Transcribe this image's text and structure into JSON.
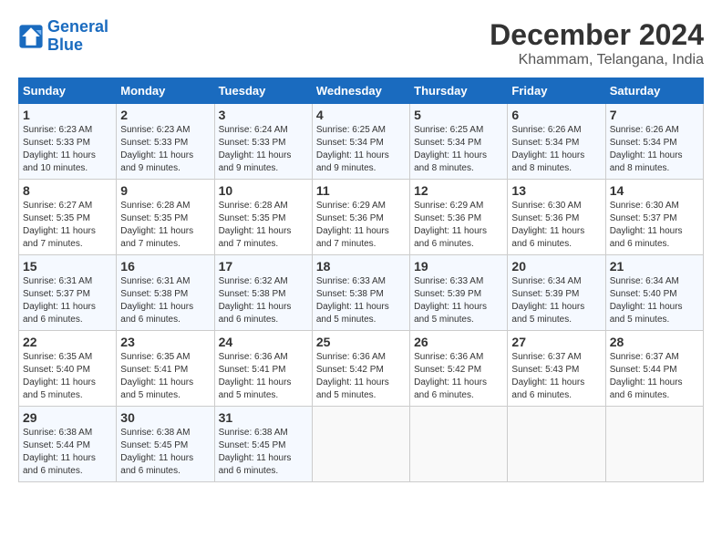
{
  "logo": {
    "line1": "General",
    "line2": "Blue"
  },
  "title": "December 2024",
  "location": "Khammam, Telangana, India",
  "headers": [
    "Sunday",
    "Monday",
    "Tuesday",
    "Wednesday",
    "Thursday",
    "Friday",
    "Saturday"
  ],
  "weeks": [
    [
      {
        "day": "1",
        "sunrise": "6:23 AM",
        "sunset": "5:33 PM",
        "daylight": "11 hours and 10 minutes."
      },
      {
        "day": "2",
        "sunrise": "6:23 AM",
        "sunset": "5:33 PM",
        "daylight": "11 hours and 9 minutes."
      },
      {
        "day": "3",
        "sunrise": "6:24 AM",
        "sunset": "5:33 PM",
        "daylight": "11 hours and 9 minutes."
      },
      {
        "day": "4",
        "sunrise": "6:25 AM",
        "sunset": "5:34 PM",
        "daylight": "11 hours and 9 minutes."
      },
      {
        "day": "5",
        "sunrise": "6:25 AM",
        "sunset": "5:34 PM",
        "daylight": "11 hours and 8 minutes."
      },
      {
        "day": "6",
        "sunrise": "6:26 AM",
        "sunset": "5:34 PM",
        "daylight": "11 hours and 8 minutes."
      },
      {
        "day": "7",
        "sunrise": "6:26 AM",
        "sunset": "5:34 PM",
        "daylight": "11 hours and 8 minutes."
      }
    ],
    [
      {
        "day": "8",
        "sunrise": "6:27 AM",
        "sunset": "5:35 PM",
        "daylight": "11 hours and 7 minutes."
      },
      {
        "day": "9",
        "sunrise": "6:28 AM",
        "sunset": "5:35 PM",
        "daylight": "11 hours and 7 minutes."
      },
      {
        "day": "10",
        "sunrise": "6:28 AM",
        "sunset": "5:35 PM",
        "daylight": "11 hours and 7 minutes."
      },
      {
        "day": "11",
        "sunrise": "6:29 AM",
        "sunset": "5:36 PM",
        "daylight": "11 hours and 7 minutes."
      },
      {
        "day": "12",
        "sunrise": "6:29 AM",
        "sunset": "5:36 PM",
        "daylight": "11 hours and 6 minutes."
      },
      {
        "day": "13",
        "sunrise": "6:30 AM",
        "sunset": "5:36 PM",
        "daylight": "11 hours and 6 minutes."
      },
      {
        "day": "14",
        "sunrise": "6:30 AM",
        "sunset": "5:37 PM",
        "daylight": "11 hours and 6 minutes."
      }
    ],
    [
      {
        "day": "15",
        "sunrise": "6:31 AM",
        "sunset": "5:37 PM",
        "daylight": "11 hours and 6 minutes."
      },
      {
        "day": "16",
        "sunrise": "6:31 AM",
        "sunset": "5:38 PM",
        "daylight": "11 hours and 6 minutes."
      },
      {
        "day": "17",
        "sunrise": "6:32 AM",
        "sunset": "5:38 PM",
        "daylight": "11 hours and 6 minutes."
      },
      {
        "day": "18",
        "sunrise": "6:33 AM",
        "sunset": "5:38 PM",
        "daylight": "11 hours and 5 minutes."
      },
      {
        "day": "19",
        "sunrise": "6:33 AM",
        "sunset": "5:39 PM",
        "daylight": "11 hours and 5 minutes."
      },
      {
        "day": "20",
        "sunrise": "6:34 AM",
        "sunset": "5:39 PM",
        "daylight": "11 hours and 5 minutes."
      },
      {
        "day": "21",
        "sunrise": "6:34 AM",
        "sunset": "5:40 PM",
        "daylight": "11 hours and 5 minutes."
      }
    ],
    [
      {
        "day": "22",
        "sunrise": "6:35 AM",
        "sunset": "5:40 PM",
        "daylight": "11 hours and 5 minutes."
      },
      {
        "day": "23",
        "sunrise": "6:35 AM",
        "sunset": "5:41 PM",
        "daylight": "11 hours and 5 minutes."
      },
      {
        "day": "24",
        "sunrise": "6:36 AM",
        "sunset": "5:41 PM",
        "daylight": "11 hours and 5 minutes."
      },
      {
        "day": "25",
        "sunrise": "6:36 AM",
        "sunset": "5:42 PM",
        "daylight": "11 hours and 5 minutes."
      },
      {
        "day": "26",
        "sunrise": "6:36 AM",
        "sunset": "5:42 PM",
        "daylight": "11 hours and 6 minutes."
      },
      {
        "day": "27",
        "sunrise": "6:37 AM",
        "sunset": "5:43 PM",
        "daylight": "11 hours and 6 minutes."
      },
      {
        "day": "28",
        "sunrise": "6:37 AM",
        "sunset": "5:44 PM",
        "daylight": "11 hours and 6 minutes."
      }
    ],
    [
      {
        "day": "29",
        "sunrise": "6:38 AM",
        "sunset": "5:44 PM",
        "daylight": "11 hours and 6 minutes."
      },
      {
        "day": "30",
        "sunrise": "6:38 AM",
        "sunset": "5:45 PM",
        "daylight": "11 hours and 6 minutes."
      },
      {
        "day": "31",
        "sunrise": "6:38 AM",
        "sunset": "5:45 PM",
        "daylight": "11 hours and 6 minutes."
      },
      null,
      null,
      null,
      null
    ]
  ]
}
